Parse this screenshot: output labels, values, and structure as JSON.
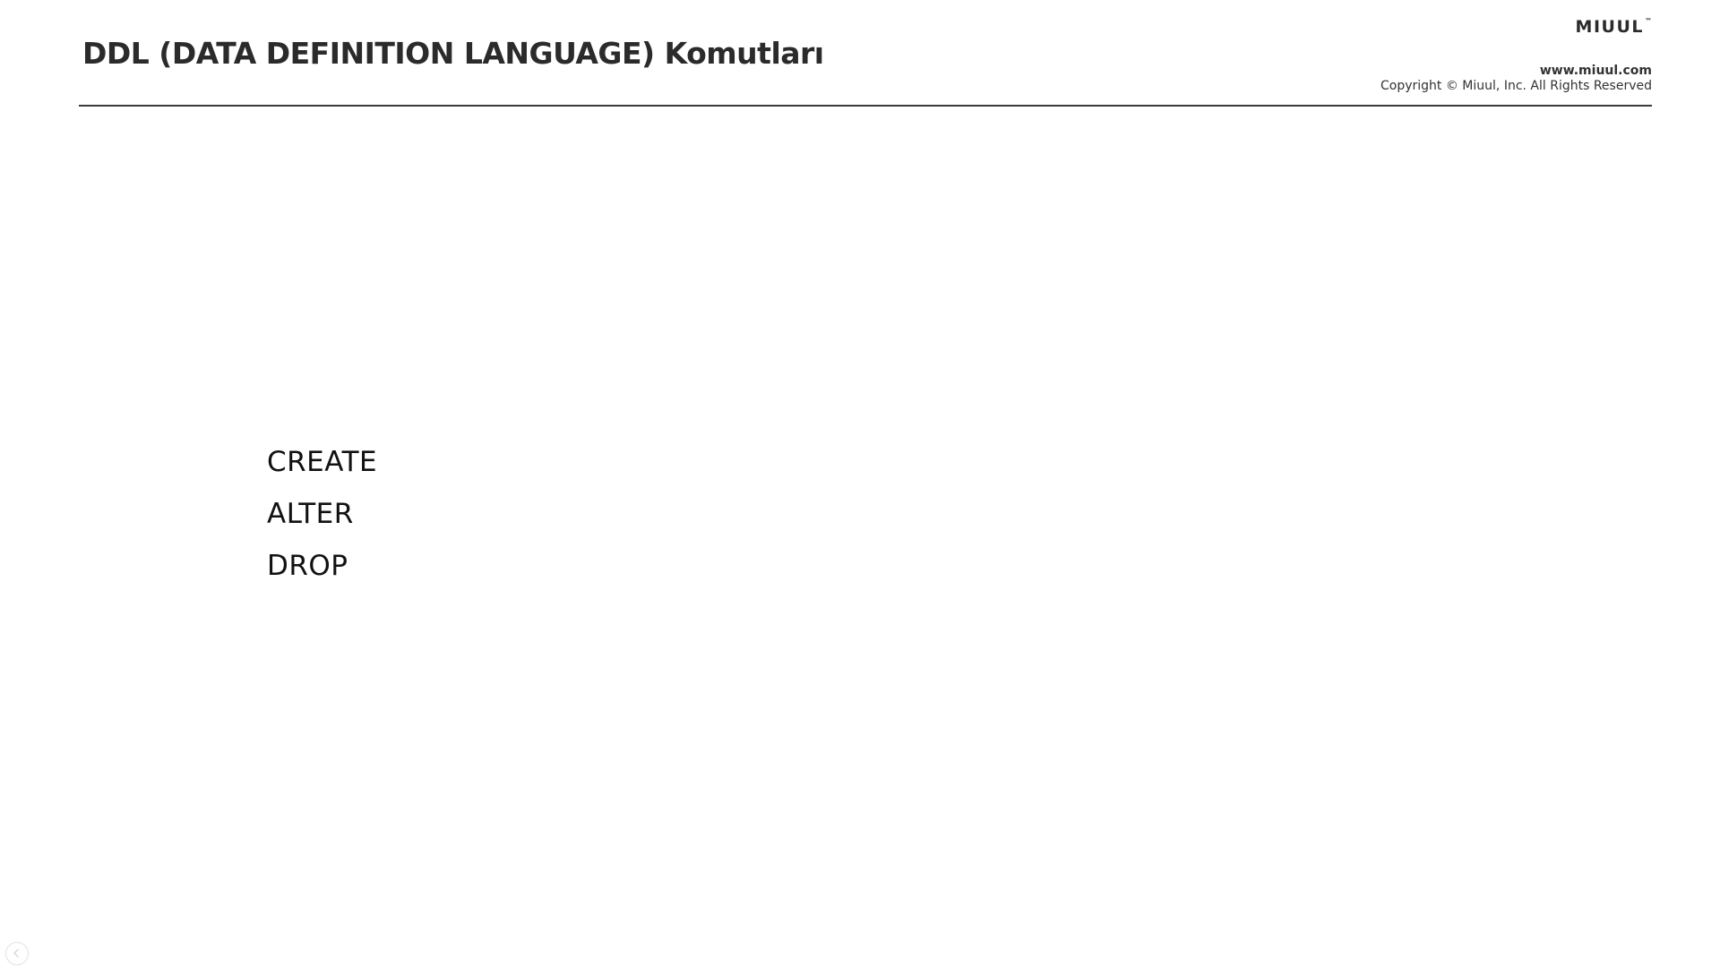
{
  "slide": {
    "title": "DDL (DATA DEFINITION LANGUAGE) Komutları",
    "brand": {
      "name": "MIUUL",
      "trademark": "™"
    },
    "website": "www.miuul.com",
    "copyright": "Copyright © Miuul, Inc. All Rights Reserved",
    "commands": [
      "CREATE",
      "ALTER",
      "DROP"
    ]
  },
  "navigation": {
    "back_icon": "chevron-left-circle-icon"
  },
  "colors": {
    "background": "#ffffff",
    "title": "#2b2b2b",
    "rule": "#3a3a3a",
    "text": "#111111"
  }
}
